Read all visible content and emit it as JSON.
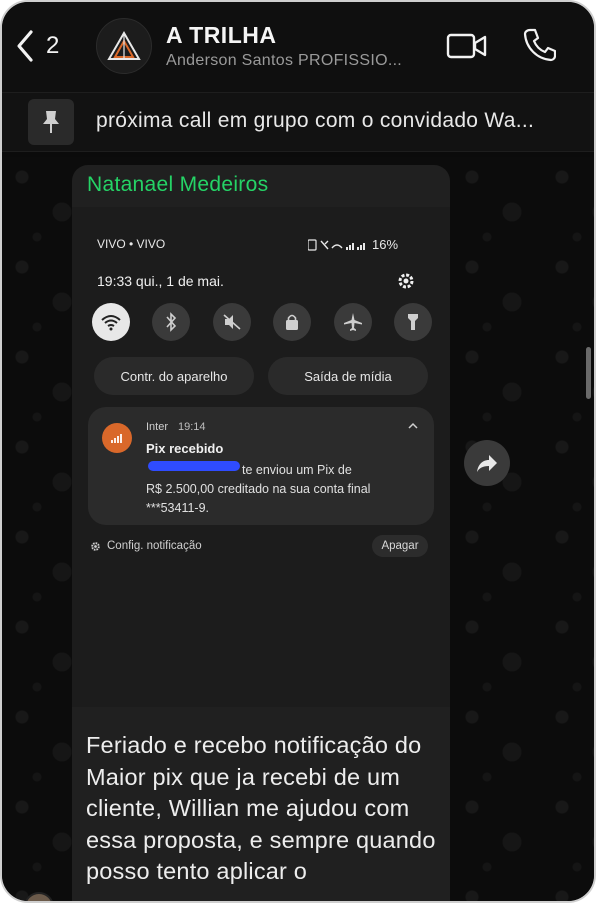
{
  "header": {
    "back_count": "2",
    "title": "A TRILHA",
    "subtitle": "Anderson Santos PROFISSIO..."
  },
  "pinned": {
    "text": "próxima call em grupo com o convidado Wa..."
  },
  "message": {
    "sender": "Natanael Medeiros",
    "caption": "Feriado e recebo notificação do Maior pix que ja recebi de um cliente, Willian me ajudou com essa proposta, e sempre quando posso tento aplicar o"
  },
  "screenshot": {
    "carrier": "VIVO • VIVO",
    "battery": "16%",
    "time_date": "19:33  qui., 1 de mai.",
    "device_control": "Contr. do aparelho",
    "media_output": "Saída de mídia",
    "notification": {
      "app": "Inter",
      "time": "19:14",
      "title": "Pix recebido",
      "body_line1": "te enviou um Pix de",
      "body_line2": "R$ 2.500,00 creditado na sua conta final",
      "body_line3": "***53411-9."
    },
    "config": "Config. notificação",
    "clear": "Apagar"
  },
  "colors": {
    "sender_name": "#25d366",
    "inter_orange": "#d9682a",
    "redaction_blue": "#2f4cff"
  }
}
